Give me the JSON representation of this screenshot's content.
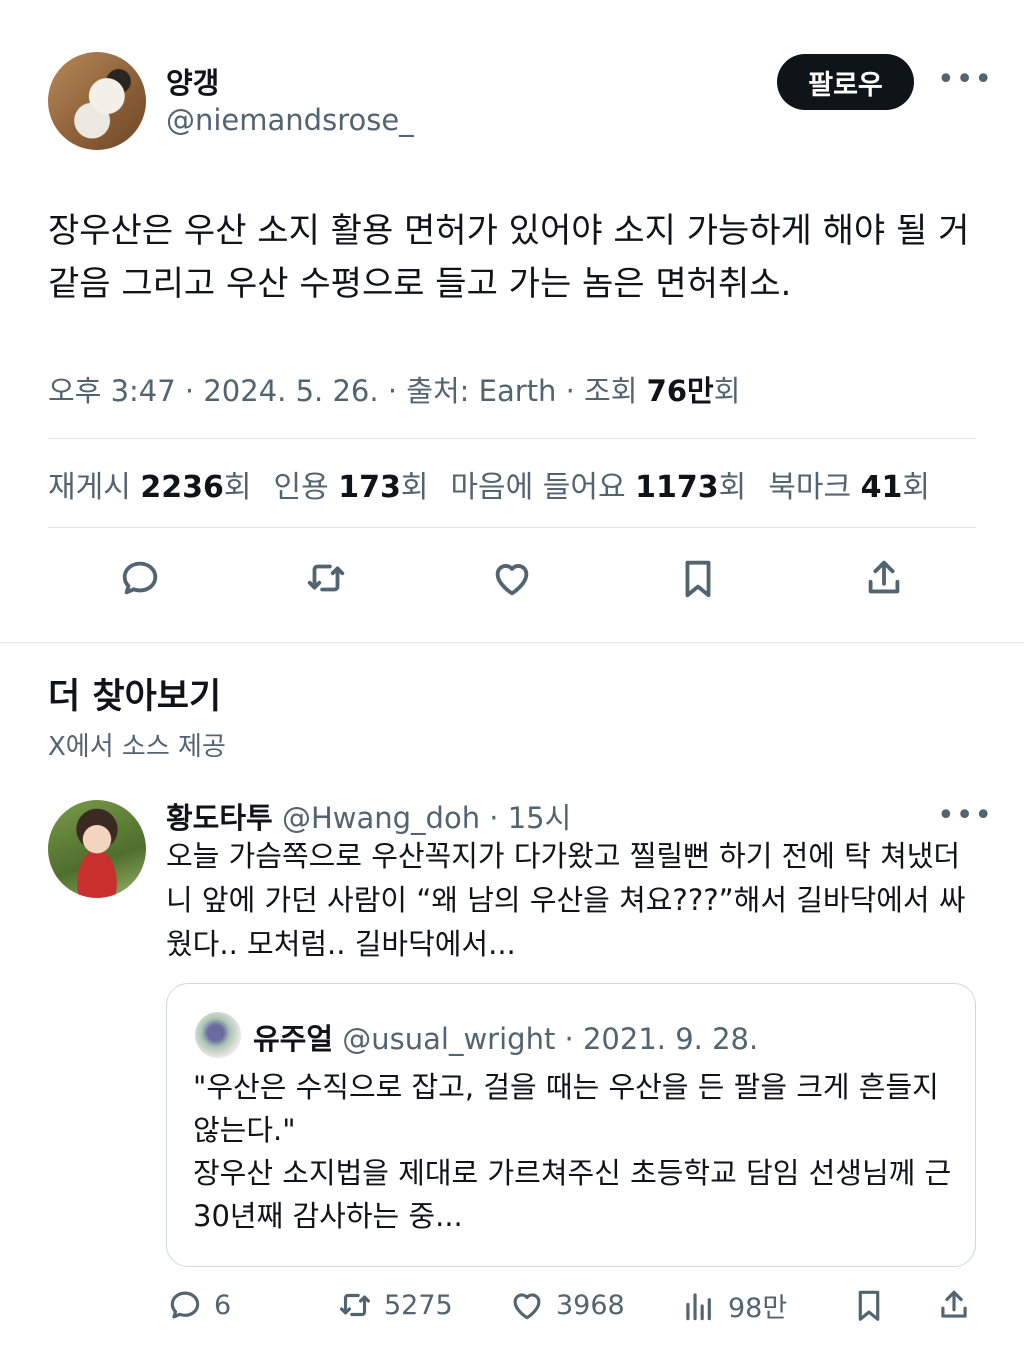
{
  "author": {
    "name": "양갱",
    "handle": "@niemandsrose_"
  },
  "follow_label": "팔로우",
  "more_label": "•••",
  "tweet": {
    "text": "장우산은 우산 소지 활용 면허가 있어야 소지 가능하게 해야 될 거 같음 그리고 우산 수평으로 들고 가는 놈은 면허취소.",
    "time": "오후 3:47",
    "date": "2024. 5. 26.",
    "source": "출처: Earth",
    "views_prefix": "조회",
    "views": "76만",
    "views_suffix": "회"
  },
  "stats": [
    {
      "label": "재게시",
      "value": "2236",
      "unit": "회"
    },
    {
      "label": "인용",
      "value": "173",
      "unit": "회"
    },
    {
      "label": "마음에 들어요",
      "value": "1173",
      "unit": "회"
    },
    {
      "label": "북마크",
      "value": "41",
      "unit": "회"
    }
  ],
  "discover": {
    "title": "더 찾아보기",
    "subtitle": "X에서 소스 제공"
  },
  "related": {
    "name": "황도타투",
    "handle": "@Hwang_doh",
    "time": "15시",
    "text": "오늘 가슴쪽으로 우산꼭지가 다가왔고 찔릴뻔 하기 전에 탁 쳐냈더니 앞에 가던 사람이 “왜 남의 우산을 쳐요???”해서 길바닥에서 싸웠다.. 모처럼.. 길바닥에서...",
    "quote": {
      "name": "유주얼",
      "handle": "@usual_wright",
      "date": "2021. 9. 28.",
      "line1": "\"우산은 수직으로 잡고, 걸을 때는 우산을 든 팔을 크게 흔들지 않는다.\"",
      "line2": "장우산 소지법을 제대로 가르쳐주신 초등학교 담임 선생님께 근 30년째 감사하는 중..."
    },
    "actions": {
      "replies": "6",
      "reposts": "5275",
      "likes": "3968",
      "views": "98만"
    }
  }
}
